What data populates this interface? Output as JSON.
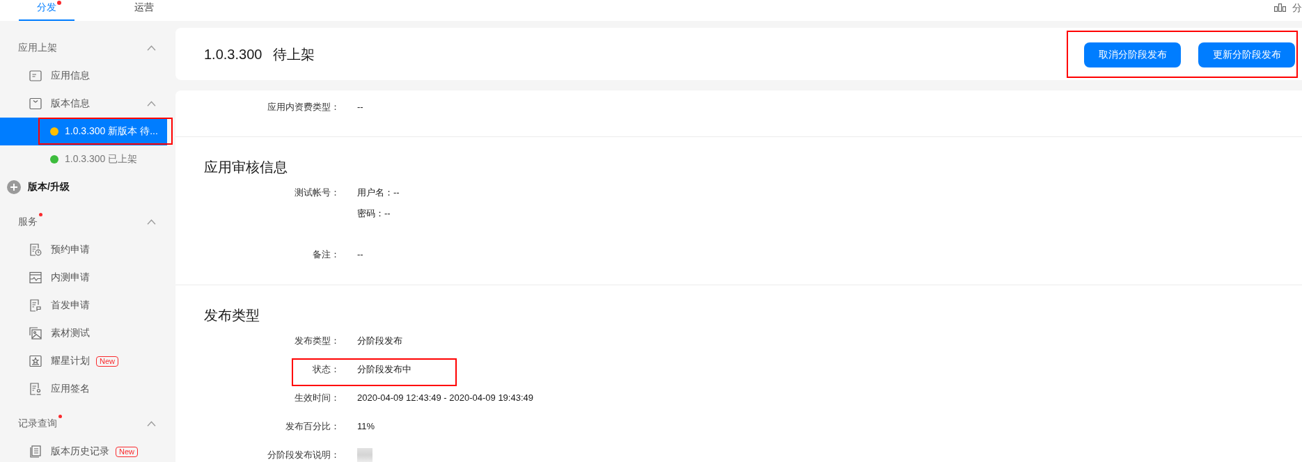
{
  "top_tabs": [
    {
      "label": "分发",
      "selected": true,
      "notice": true
    },
    {
      "label": "运营",
      "selected": false,
      "notice": false
    }
  ],
  "top_right": {
    "label": "分"
  },
  "sidebar": [
    {
      "kind": "section",
      "title": "应用上架",
      "notice": false,
      "expanded": true,
      "items": [
        {
          "label": "应用信息"
        },
        {
          "label": "版本信息",
          "expanded": true,
          "children": [
            {
              "label": "1.0.3.300 新版本 待...",
              "color": "#ffbf00",
              "selected": true,
              "annotated": true
            },
            {
              "label": "1.0.3.300 已上架",
              "color": "#3dbc3d",
              "selected": false,
              "annotated": false
            }
          ]
        }
      ]
    },
    {
      "kind": "action",
      "label": "版本/升级"
    },
    {
      "kind": "section",
      "title": "服务",
      "notice": true,
      "expanded": true,
      "items": [
        {
          "label": "预约申请"
        },
        {
          "label": "内测申请"
        },
        {
          "label": "首发申请"
        },
        {
          "label": "素材测试"
        },
        {
          "label": "耀星计划",
          "badge": "New"
        },
        {
          "label": "应用签名"
        }
      ]
    },
    {
      "kind": "section",
      "title": "记录查询",
      "notice": true,
      "expanded": true,
      "items": [
        {
          "label": "版本历史记录",
          "badge": "New"
        }
      ]
    }
  ],
  "header": {
    "version": "1.0.3.300",
    "status": "待上架",
    "annotated": true,
    "actions": [
      {
        "label": "取消分阶段发布"
      },
      {
        "label": "更新分阶段发布"
      }
    ]
  },
  "sections": [
    {
      "fields": [
        {
          "kind": "text",
          "label": "应用内资费类型：",
          "values": [
            "--"
          ],
          "annotated": false
        }
      ]
    },
    {
      "title": "应用审核信息",
      "fields": [
        {
          "kind": "text",
          "label": "测试帐号：",
          "values": [
            "用户名：--",
            "密码：--"
          ],
          "annotated": false
        },
        {
          "kind": "text",
          "label": "备注：",
          "values": [
            "--"
          ],
          "annotated": false
        }
      ]
    },
    {
      "title": "发布类型",
      "fields": [
        {
          "kind": "text",
          "label": "发布类型：",
          "values": [
            "分阶段发布"
          ],
          "annotated": false
        },
        {
          "kind": "text",
          "label": "状态：",
          "values": [
            "分阶段发布中"
          ],
          "annotated": true
        },
        {
          "kind": "text",
          "label": "生效时间：",
          "values": [
            "2020-04-09 12:43:49 - 2020-04-09 19:43:49"
          ],
          "annotated": false
        },
        {
          "kind": "text",
          "label": "发布百分比：",
          "values": [
            "11%"
          ],
          "annotated": false
        },
        {
          "kind": "redacted",
          "label": "分阶段发布说明：",
          "annotated": false
        }
      ]
    }
  ]
}
